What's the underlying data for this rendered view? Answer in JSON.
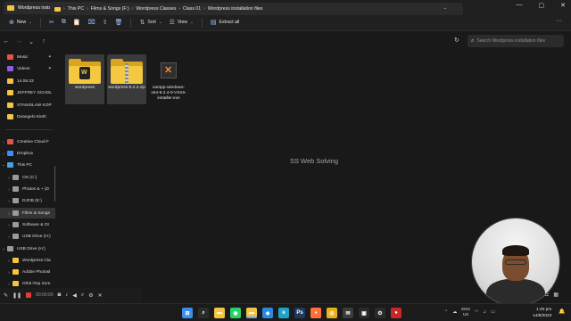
{
  "window": {
    "tab_title": "Wordpress installation files",
    "new_tab": "+",
    "close_tab": "✕"
  },
  "toolbar": {
    "new_label": "New",
    "sort_label": "Sort",
    "view_label": "View",
    "extract_label": "Extract all",
    "more": "···"
  },
  "address": {
    "crumbs": [
      "This PC",
      "Films & Songs (F:)",
      "Wordpress Classes",
      "Class 01",
      "Wordpress installation files"
    ],
    "search_placeholder": "Search Wordpress installation files"
  },
  "sidebar": {
    "quick_access": [
      {
        "label": "Music",
        "icon": "music-icon",
        "color": "#e5534b",
        "pinned": true
      },
      {
        "label": "Videos",
        "icon": "video-icon",
        "color": "#8e5ce6",
        "pinned": true
      },
      {
        "label": "14.08.23",
        "icon": "folder-icon",
        "color": "#f4c542",
        "pinned": false
      },
      {
        "label": "JEFFREY SCHOL",
        "icon": "folder-icon",
        "color": "#f4c542",
        "pinned": false
      },
      {
        "label": "STANISLAW KOP",
        "icon": "folder-icon",
        "color": "#f4c542",
        "pinned": false
      },
      {
        "label": "Deangelo Kieth",
        "icon": "folder-icon",
        "color": "#f4c542",
        "pinned": false
      }
    ],
    "locations": [
      {
        "label": "Creative Cloud F",
        "icon": "creative-cloud-icon",
        "color": "#e5534b",
        "expand": "›",
        "selected": false
      },
      {
        "label": "Dropbox",
        "icon": "dropbox-icon",
        "color": "#3d8bfd",
        "expand": "›",
        "selected": false
      },
      {
        "label": "This PC",
        "icon": "this-pc-icon",
        "color": "#4aa3df",
        "expand": "⌄",
        "selected": false
      },
      {
        "label": "OS (C:)",
        "icon": "drive-icon",
        "color": "#9a9a9a",
        "expand": "›",
        "selected": false
      },
      {
        "label": "Photos & + (D",
        "icon": "drive-icon",
        "color": "#9a9a9a",
        "expand": "›",
        "selected": false
      },
      {
        "label": "DJOB (E:)",
        "icon": "drive-icon",
        "color": "#9a9a9a",
        "expand": "›",
        "selected": false
      },
      {
        "label": "Films & Songs",
        "icon": "drive-icon",
        "color": "#9a9a9a",
        "expand": "›",
        "selected": true
      },
      {
        "label": "Software & Ot",
        "icon": "drive-icon",
        "color": "#9a9a9a",
        "expand": "›",
        "selected": false
      },
      {
        "label": "USB Drive (H:)",
        "icon": "usb-drive-icon",
        "color": "#9a9a9a",
        "expand": "›",
        "selected": false
      },
      {
        "label": "USB Drive (H:)",
        "icon": "usb-drive-icon",
        "color": "#9a9a9a",
        "expand": "⌄",
        "selected": false
      },
      {
        "label": "Wordpress Cla",
        "icon": "folder-icon",
        "color": "#f4c542",
        "expand": "›",
        "selected": false
      },
      {
        "label": "Adobe Photosl",
        "icon": "folder-icon",
        "color": "#f4c542",
        "expand": "›",
        "selected": false
      },
      {
        "label": "IObit iTop Scre",
        "icon": "folder-icon",
        "color": "#f4c542",
        "expand": "›",
        "selected": false
      }
    ]
  },
  "files": [
    {
      "name": "wordpress",
      "icon": "folder-icon",
      "selected": true
    },
    {
      "name": "wordpress-6.2.2.zip",
      "icon": "zip-folder-icon",
      "selected": true
    },
    {
      "name": "xampp-windows-x64-8.2.4-0-VS16-installer.exe",
      "icon": "xampp-installer-icon",
      "selected": false
    }
  ],
  "watermark": "SS Web Solving",
  "recorder": {
    "time": "00:00:00"
  },
  "taskbar": {
    "apps": [
      {
        "icon": "windows-start-icon",
        "color": "#3b8eea",
        "glyph": "⊞"
      },
      {
        "icon": "search-icon",
        "color": "#2b2b2b",
        "glyph": "⌕"
      },
      {
        "icon": "file-explorer-icon",
        "color": "#f4c542",
        "glyph": "▬"
      },
      {
        "icon": "whatsapp-icon",
        "color": "#25d366",
        "glyph": "◉"
      },
      {
        "icon": "file-explorer-active-icon",
        "color": "#f4c542",
        "glyph": "▬"
      },
      {
        "icon": "vscode-icon",
        "color": "#2a8ae0",
        "glyph": "◆"
      },
      {
        "icon": "edge-icon",
        "color": "#1fa4c9",
        "glyph": "e"
      },
      {
        "icon": "photoshop-icon",
        "color": "#1d3a5c",
        "glyph": "Ps"
      },
      {
        "icon": "firefox-icon",
        "color": "#ff7139",
        "glyph": "◕"
      },
      {
        "icon": "chrome-icon",
        "color": "#e8b21f",
        "glyph": "◎"
      },
      {
        "icon": "mail-icon",
        "color": "#3b3b3b",
        "glyph": "✉"
      },
      {
        "icon": "store-icon",
        "color": "#2b2b2b",
        "glyph": "▣"
      },
      {
        "icon": "settings-icon",
        "color": "#2b2b2b",
        "glyph": "⚙"
      },
      {
        "icon": "recorder-icon",
        "color": "#c62828",
        "glyph": "●"
      }
    ],
    "lang_top": "ENG",
    "lang_bottom": "US",
    "time": "1:20 pm",
    "date": "14/8/2023"
  }
}
